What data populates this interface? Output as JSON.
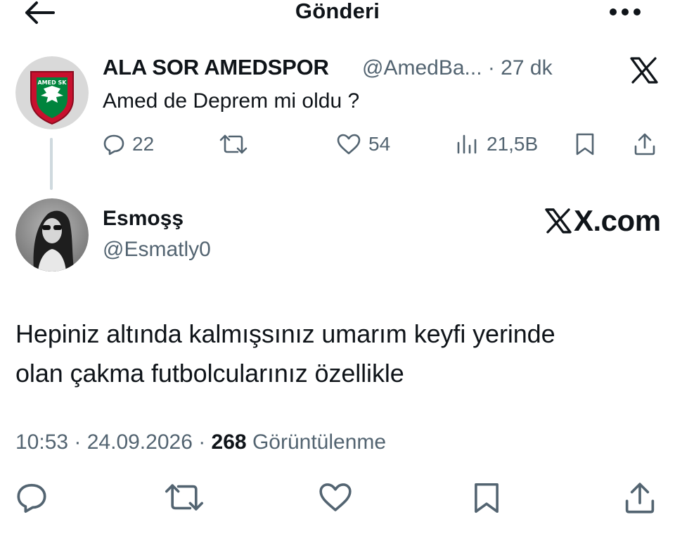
{
  "header": {
    "title": "Gönderi"
  },
  "quoted_tweet": {
    "author_name": "ALA SOR AMEDSPOR",
    "handle_time": "@AmedBa... · 27 dk",
    "text": "Amed de Deprem mi oldu ?",
    "avatar_text": "AMED SK",
    "brand_colors": {
      "red": "#c8102e",
      "green": "#00843d"
    },
    "actions": {
      "replies": "22",
      "likes": "54",
      "views": "21,5B"
    }
  },
  "reply_tweet": {
    "author_name": "Esmoşş",
    "handle": "@Esmatly0",
    "watermark": "X.com",
    "text_line1": "Hepiniz altında kalmışsınız umarım keyfi yerinde",
    "text_line2": "olan çakma futbolcularınız özellikle",
    "timestamp": "10:53 · 24.09.2026 · ",
    "view_count": "268",
    "view_label": " Görüntülenme"
  },
  "colors": {
    "text": "#0f1419",
    "muted": "#536471",
    "divider": "#cfd9de"
  }
}
